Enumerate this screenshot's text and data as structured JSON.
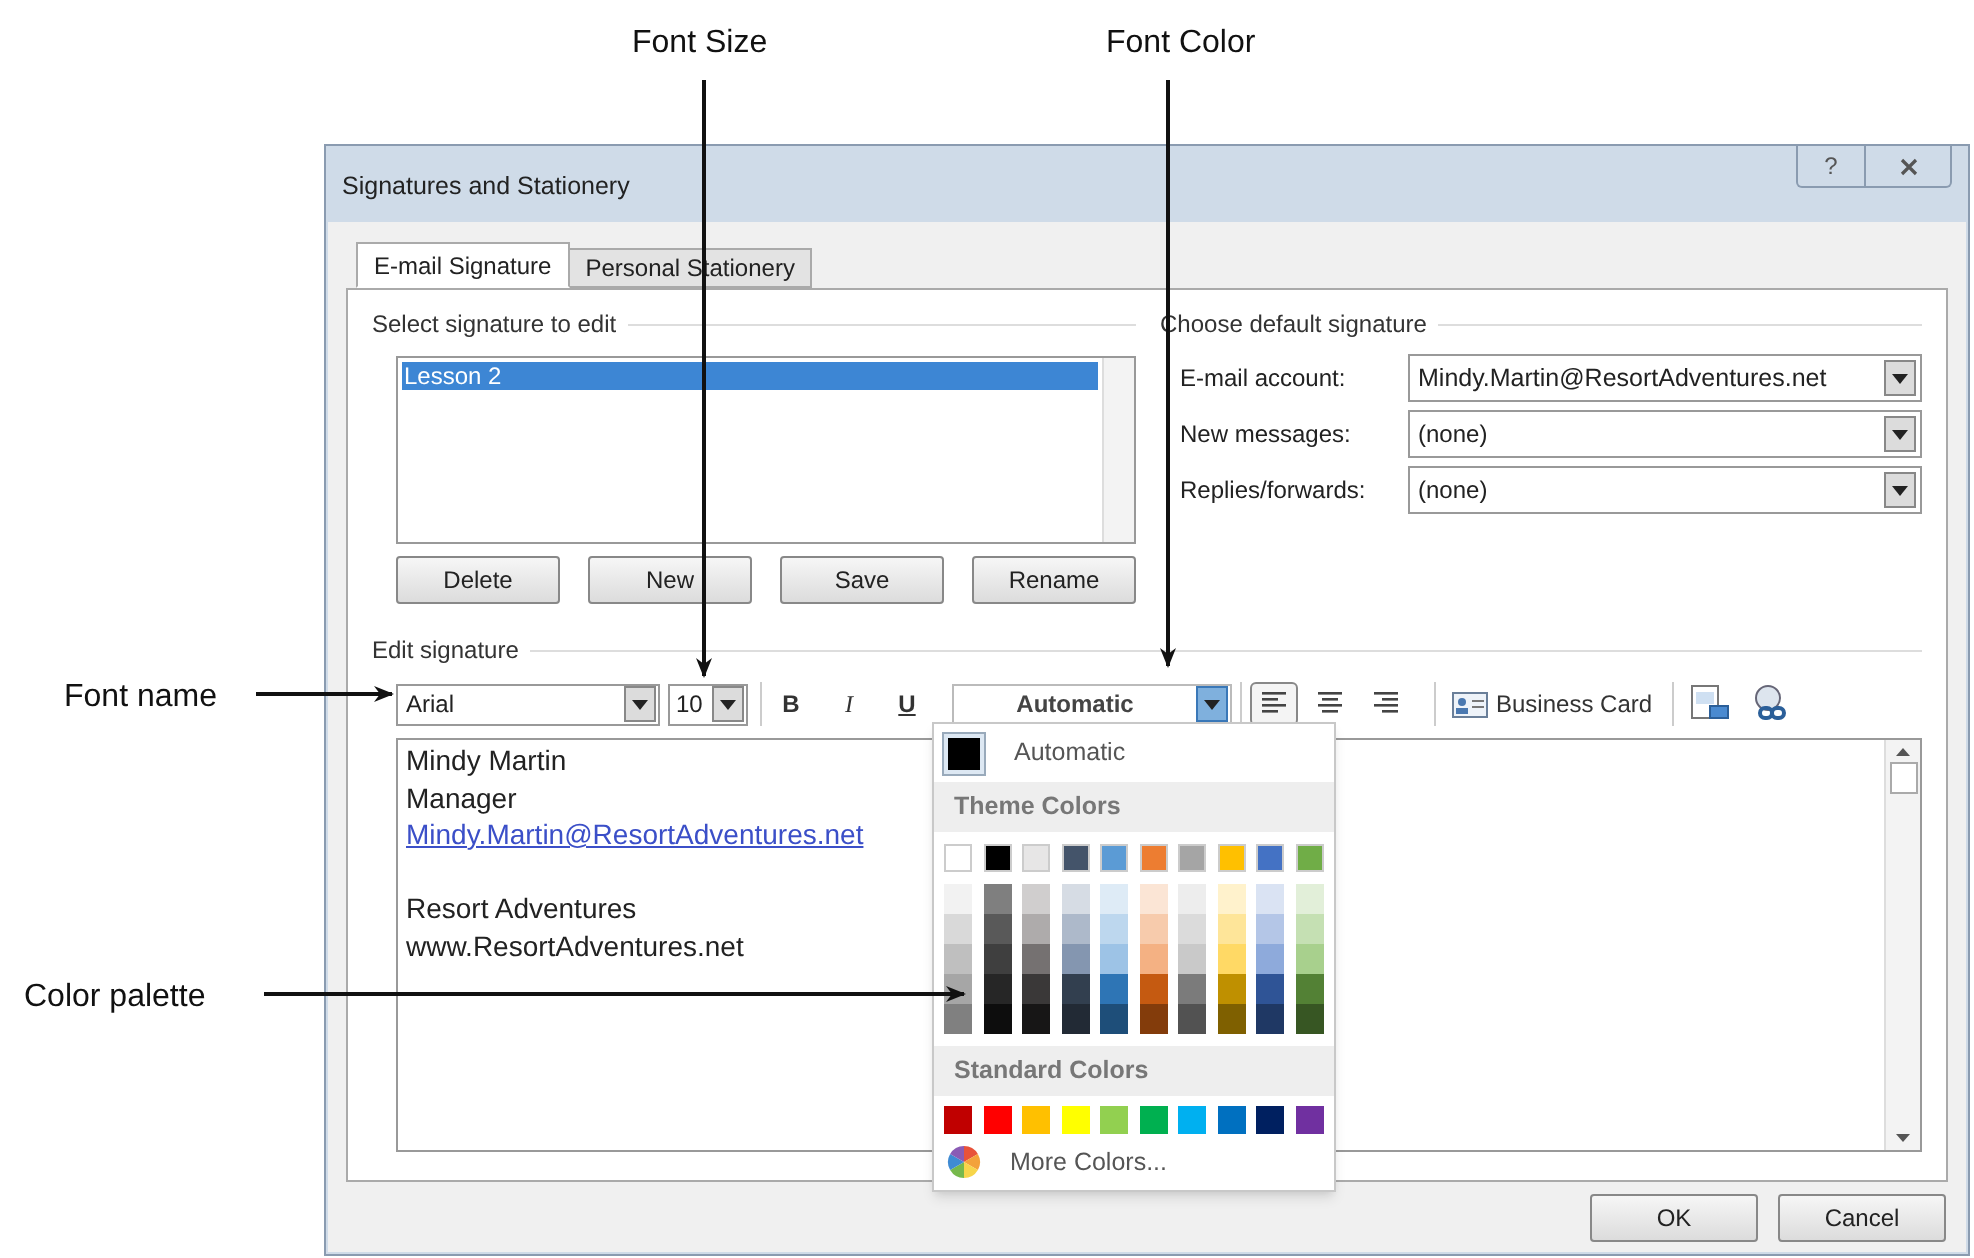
{
  "callouts": [
    {
      "label": "Font Size"
    },
    {
      "label": "Font Color"
    },
    {
      "label": "Font name"
    },
    {
      "label": "Color palette"
    }
  ],
  "window": {
    "title": "Signatures and Stationery",
    "help": "?"
  },
  "tabs": [
    {
      "label": "E-mail Signature",
      "selected": true
    },
    {
      "label": "Personal Stationery",
      "selected": false
    }
  ],
  "select_signature": {
    "heading": "Select signature to edit",
    "items": [
      {
        "label": "Lesson 2",
        "selected": true
      }
    ],
    "buttons": [
      "Delete",
      "New",
      "Save",
      "Rename"
    ]
  },
  "default_signature": {
    "heading": "Choose default signature",
    "fields": [
      {
        "label": "E-mail account:",
        "value": "Mindy.Martin@ResortAdventures.net"
      },
      {
        "label": "New messages:",
        "value": "(none)"
      },
      {
        "label": "Replies/forwards:",
        "value": "(none)"
      }
    ]
  },
  "edit_signature": {
    "heading": "Edit signature",
    "font_name": "Arial",
    "font_size": "10",
    "format_buttons": [
      {
        "label": "B",
        "kind": "bold"
      },
      {
        "label": "I",
        "kind": "italic"
      },
      {
        "label": "U",
        "kind": "underline"
      }
    ],
    "font_color": {
      "value": "Automatic",
      "expanded": true
    },
    "align_buttons": [
      {
        "kind": "left",
        "selected": true
      },
      {
        "kind": "center",
        "selected": false
      },
      {
        "kind": "right",
        "selected": false
      }
    ],
    "business_card": "Business Card",
    "lines": [
      {
        "text": "Mindy Martin",
        "kind": "text"
      },
      {
        "text": "Manager",
        "kind": "text"
      },
      {
        "text": "Mindy.Martin@ResortAdventures.net",
        "kind": "link"
      },
      {
        "kind": "blank"
      },
      {
        "text": "Resort Adventures",
        "kind": "text"
      },
      {
        "text": "www.ResortAdventures.net",
        "kind": "text"
      }
    ]
  },
  "color_menu": {
    "automatic": "Automatic",
    "theme_heading": "Theme Colors",
    "theme_colors": [
      {
        "color": "#ffffff",
        "shades": [
          {
            "color": "#f2f2f2"
          },
          {
            "color": "#d9d9d9"
          },
          {
            "color": "#bfbfbf"
          },
          {
            "color": "#a6a6a6"
          },
          {
            "color": "#808080"
          }
        ]
      },
      {
        "color": "#000000",
        "shades": [
          {
            "color": "#7f7f7f"
          },
          {
            "color": "#595959"
          },
          {
            "color": "#3f3f3f"
          },
          {
            "color": "#262626"
          },
          {
            "color": "#0d0d0d"
          }
        ]
      },
      {
        "color": "#e7e6e6",
        "shades": [
          {
            "color": "#d0cece"
          },
          {
            "color": "#aeabab"
          },
          {
            "color": "#757171"
          },
          {
            "color": "#3a3838"
          },
          {
            "color": "#171616"
          }
        ]
      },
      {
        "color": "#44546a",
        "shades": [
          {
            "color": "#d6dce4"
          },
          {
            "color": "#adb9ca"
          },
          {
            "color": "#8496b0"
          },
          {
            "color": "#323f4f"
          },
          {
            "color": "#222a35"
          }
        ]
      },
      {
        "color": "#5b9bd5",
        "shades": [
          {
            "color": "#deebf6"
          },
          {
            "color": "#bdd7ee"
          },
          {
            "color": "#9dc3e6"
          },
          {
            "color": "#2e75b5"
          },
          {
            "color": "#1e4e79"
          }
        ]
      },
      {
        "color": "#ed7d31",
        "shades": [
          {
            "color": "#fbe5d5"
          },
          {
            "color": "#f7cbac"
          },
          {
            "color": "#f4b183"
          },
          {
            "color": "#c55a11"
          },
          {
            "color": "#833c0b"
          }
        ]
      },
      {
        "color": "#a5a5a5",
        "shades": [
          {
            "color": "#ededed"
          },
          {
            "color": "#dbdbdb"
          },
          {
            "color": "#c9c9c9"
          },
          {
            "color": "#7b7b7b"
          },
          {
            "color": "#525252"
          }
        ]
      },
      {
        "color": "#ffc000",
        "shades": [
          {
            "color": "#fff2cc"
          },
          {
            "color": "#fee599"
          },
          {
            "color": "#ffd965"
          },
          {
            "color": "#bf9000"
          },
          {
            "color": "#7f6000"
          }
        ]
      },
      {
        "color": "#4472c4",
        "shades": [
          {
            "color": "#dae3f3"
          },
          {
            "color": "#b4c6e7"
          },
          {
            "color": "#8eaadb"
          },
          {
            "color": "#2f5496"
          },
          {
            "color": "#1f3864"
          }
        ]
      },
      {
        "color": "#70ad47",
        "shades": [
          {
            "color": "#e2efd9"
          },
          {
            "color": "#c5e0b3"
          },
          {
            "color": "#a8d08d"
          },
          {
            "color": "#538135"
          },
          {
            "color": "#375623"
          }
        ]
      }
    ],
    "standard_heading": "Standard Colors",
    "standard_colors": [
      {
        "color": "#c00000"
      },
      {
        "color": "#ff0000"
      },
      {
        "color": "#ffc000"
      },
      {
        "color": "#ffff00"
      },
      {
        "color": "#92d050"
      },
      {
        "color": "#00b050"
      },
      {
        "color": "#00b0f0"
      },
      {
        "color": "#0070c0"
      },
      {
        "color": "#002060"
      },
      {
        "color": "#7030a0"
      }
    ],
    "more": "More Colors..."
  },
  "footer_buttons": [
    "OK",
    "Cancel"
  ]
}
